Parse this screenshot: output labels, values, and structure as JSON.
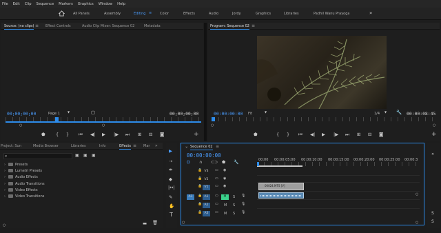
{
  "menu": [
    "File",
    "Edit",
    "Clip",
    "Sequence",
    "Markers",
    "Graphics",
    "Window",
    "Help"
  ],
  "workspaces": {
    "tabs": [
      "All Panels",
      "Assembly",
      "Editing",
      "Color",
      "Effects",
      "Audio",
      "Jordy",
      "Graphics",
      "Libraries",
      "Padhil Wanu Prayoga"
    ],
    "active": "Editing",
    "more": "»"
  },
  "source_panel": {
    "tabs": [
      "Source: (no clips)",
      "Effect Controls",
      "Audio Clip Mixer: Sequence 02",
      "Metadata"
    ],
    "menu_icon": "≡",
    "timecode_in": "00;00;00;00",
    "page": "Page 1",
    "timecode_out": "00;00;00;00"
  },
  "program_panel": {
    "title": "Program: Sequence 02",
    "menu_icon": "≡",
    "timecode_in": "00:00:00:00",
    "fit": "Fit",
    "resolution": "1/4",
    "timecode_out": "00:00:08:45"
  },
  "project_panel": {
    "tabs": [
      "Project: Sun",
      "Media Browser",
      "Libraries",
      "Info",
      "Effects",
      "Mar"
    ],
    "active": "Effects",
    "more": "»",
    "effects": [
      "Presets",
      "Lumetri Presets",
      "Audio Effects",
      "Audio Transitions",
      "Video Effects",
      "Video Transitions"
    ]
  },
  "timeline": {
    "tab": "Sequence 02",
    "timecode": "00:00:00:00",
    "ruler": [
      "00:00",
      "00:00:05:00",
      "00:00:10:00",
      "00:00:15:00",
      "00:00:20:00",
      "00:00:25:00",
      "00:00:3"
    ],
    "video_tracks": [
      "V3",
      "V2",
      "V1"
    ],
    "audio_tracks": [
      "A1",
      "A2",
      "A3"
    ],
    "source_patch_video": "V1",
    "source_patch_audio": "A1",
    "mute": "M",
    "solo": "S",
    "clip_video_label": "00024.MTS [V]"
  },
  "colors": {
    "accent": "#2d8ceb",
    "timecode": "#4a9dff",
    "clip_video": "#9e9e9e",
    "clip_audio": "#5a8ab5"
  }
}
